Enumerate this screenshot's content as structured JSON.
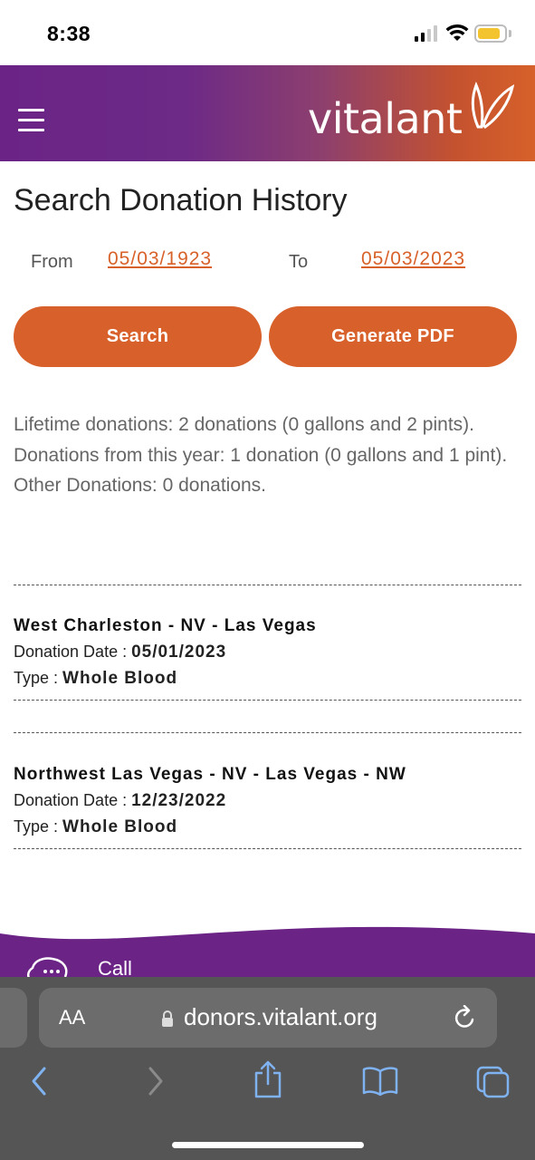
{
  "status_bar": {
    "time": "8:38"
  },
  "header": {
    "brand": "vitalant",
    "menu_icon": "hamburger-menu-icon",
    "logo_icon": "vitalant-leaf-logo"
  },
  "page": {
    "title": "Search Donation History"
  },
  "date_range": {
    "from_label": "From",
    "from_value": "05/03/1923",
    "to_label": "To",
    "to_value": "05/03/2023"
  },
  "actions": {
    "search_label": "Search",
    "pdf_label": "Generate PDF"
  },
  "summary": {
    "lifetime": "Lifetime donations: 2 donations (0 gallons and 2 pints).",
    "this_year": "Donations from this year: 1 donation (0 gallons and 1 pint).",
    "other": "Other Donations: 0 donations."
  },
  "donations": [
    {
      "location": "West Charleston - NV - Las Vegas",
      "date_label": "Donation Date : ",
      "date": "05/01/2023",
      "type_label": "Type : ",
      "type": "Whole Blood"
    },
    {
      "location": "Northwest Las Vegas - NV - Las Vegas - NW",
      "date_label": "Donation Date : ",
      "date": "12/23/2022",
      "type_label": "Type : ",
      "type": "Whole Blood"
    }
  ],
  "footer": {
    "call_label": "Call"
  },
  "browser": {
    "aa_label": "AA",
    "url": "donors.vitalant.org"
  },
  "colors": {
    "accent": "#d8602a",
    "brand_purple": "#6b2486",
    "toolbar": "#555555",
    "toolbar_icon": "#7fb2f0"
  }
}
